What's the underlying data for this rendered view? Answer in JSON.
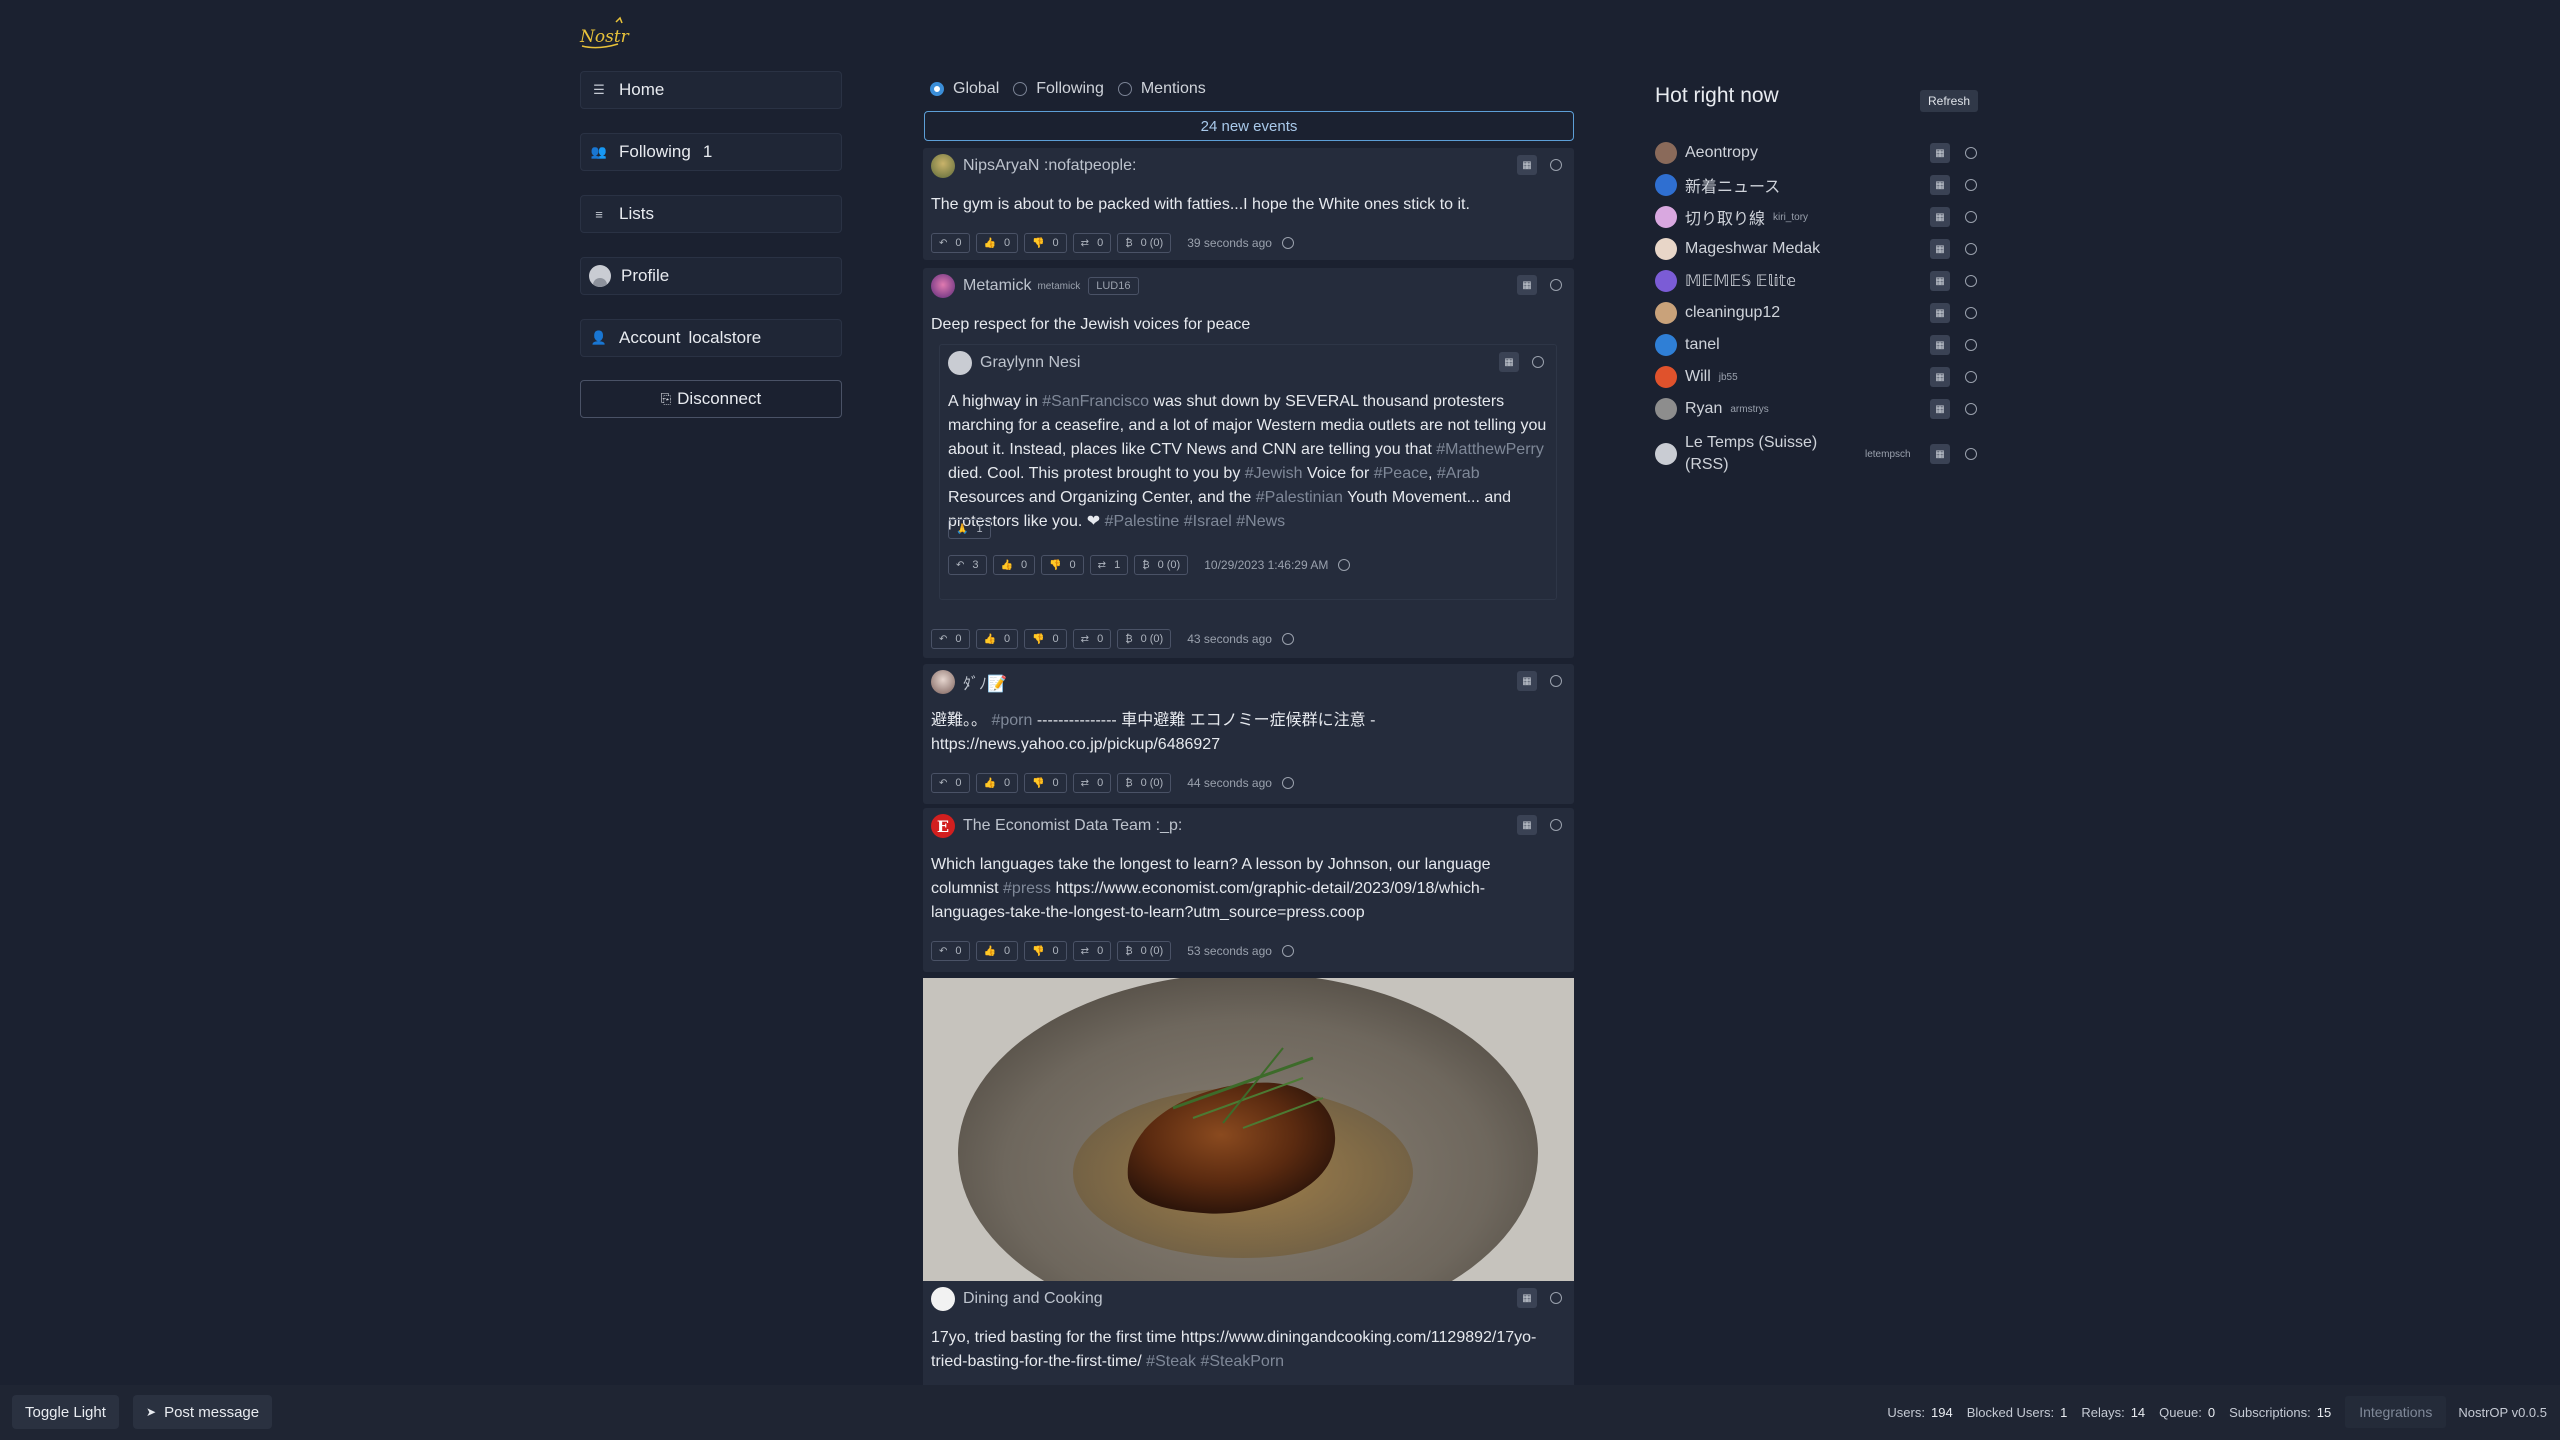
{
  "app": {
    "logo_text": "NOSTR",
    "version": "NostrOP v0.0.5"
  },
  "nav": {
    "home": "Home",
    "following": "Following",
    "following_count": "1",
    "lists": "Lists",
    "profile": "Profile",
    "account": "Account",
    "account_value": "localstore",
    "disconnect": "Disconnect"
  },
  "feed": {
    "filters": [
      {
        "label": "Global",
        "selected": true
      },
      {
        "label": "Following",
        "selected": false
      },
      {
        "label": "Mentions",
        "selected": false
      }
    ],
    "new_events": "24 new events",
    "posts": [
      {
        "author": "NipsAryaN :nofatpeople:",
        "content": "The gym is about to be packed with fatties...I hope the White ones stick to it.",
        "actions": {
          "reply": "0",
          "like": "0",
          "dislike": "0",
          "repost": "0",
          "zap": "0 (0)"
        },
        "time": "39 seconds ago"
      },
      {
        "author": "Metamick",
        "nip05": "metamick",
        "badge": "LUD16",
        "content": "Deep respect for the Jewish voices for peace",
        "quoted": {
          "author": "Graylynn Nesi",
          "content_parts": [
            {
              "t": "A highway in "
            },
            {
              "tag": "#SanFrancisco"
            },
            {
              "t": " was shut down by SEVERAL thousand protesters marching for a ceasefire, and a lot of major Western media outlets are not telling you about it. Instead, places like CTV News and CNN are telling you that "
            },
            {
              "tag": "#MatthewPerry"
            },
            {
              "t": " died. Cool. This protest brought to you by "
            },
            {
              "tag": "#Jewish"
            },
            {
              "t": " Voice for "
            },
            {
              "tag": "#Peace"
            },
            {
              "t": ", "
            },
            {
              "tag": "#Arab"
            },
            {
              "t": " Resources and Organizing Center, and the "
            },
            {
              "tag": "#Palestinian"
            },
            {
              "t": " Youth Movement... and protestors like you. ❤ "
            },
            {
              "tag": "#Palestine"
            },
            {
              "t": " "
            },
            {
              "tag": "#Israel"
            },
            {
              "t": " "
            },
            {
              "tag": "#News"
            }
          ],
          "reaction": "1",
          "actions": {
            "reply": "3",
            "like": "0",
            "dislike": "0",
            "repost": "1",
            "zap": "0 (0)"
          },
          "time": "10/29/2023 1:46:29 AM"
        },
        "actions": {
          "reply": "0",
          "like": "0",
          "dislike": "0",
          "repost": "0",
          "zap": "0 (0)"
        },
        "time": "43 seconds ago"
      },
      {
        "author": "ﾀﾞﾉ📝",
        "content_parts": [
          {
            "t": "避難。。"
          },
          {
            "tag": " #porn"
          },
          {
            "t": " --------------- 車中避難 エコノミー症候群に注意 - https://news.yahoo.co.jp/pickup/6486927"
          }
        ],
        "actions": {
          "reply": "0",
          "like": "0",
          "dislike": "0",
          "repost": "0",
          "zap": "0 (0)"
        },
        "time": "44 seconds ago"
      },
      {
        "author": "The Economist Data Team :_p:",
        "content_parts": [
          {
            "t": "Which languages take the longest to learn? A lesson by Johnson, our language columnist "
          },
          {
            "tag": "#press"
          },
          {
            "t": " https://www.economist.com/graphic-detail/2023/09/18/which-languages-take-the-longest-to-learn?utm_source=press.coop"
          }
        ],
        "actions": {
          "reply": "0",
          "like": "0",
          "dislike": "0",
          "repost": "0",
          "zap": "0 (0)"
        },
        "time": "53 seconds ago"
      },
      {
        "author": "Dining and Cooking",
        "content_parts": [
          {
            "t": "17yo, tried basting for the first time https://www.diningandcooking.com/1129892/17yo-tried-basting-for-the-first-time/ "
          },
          {
            "tag": "#Steak"
          },
          {
            "t": " "
          },
          {
            "tag": "#SteakPorn"
          }
        ]
      }
    ]
  },
  "hot": {
    "title": "Hot right now",
    "refresh": "Refresh",
    "items": [
      {
        "name": "Aeontropy",
        "sub": "",
        "color": "#8a6a5a"
      },
      {
        "name": "新着ニュース",
        "sub": "",
        "color": "#2f6fd1"
      },
      {
        "name": "切り取り線",
        "sub": "kiri_tory",
        "color": "#d9a8e0"
      },
      {
        "name": "Mageshwar Medak",
        "sub": "",
        "color": "#e8d6c8"
      },
      {
        "name": "𝕄𝔼𝕄𝔼𝕊 𝔼𝕝𝕚𝕥𝕖",
        "sub": "",
        "color": "#7b5cd6"
      },
      {
        "name": "cleaningup12",
        "sub": "",
        "color": "#c9a27a"
      },
      {
        "name": "tanel",
        "sub": "",
        "color": "#2f7fd6"
      },
      {
        "name": "Will",
        "sub": "jb55",
        "color": "#e0522c"
      },
      {
        "name": "Ryan",
        "sub": "armstrys",
        "color": "#8d8d8d"
      },
      {
        "name": "Le Temps (Suisse) (RSS)",
        "sub": "letempsch",
        "color": "#c9ccd3"
      }
    ]
  },
  "bottom": {
    "toggle": "Toggle Light",
    "post": "Post message",
    "users_label": "Users:",
    "users": "194",
    "blocked_label": "Blocked Users:",
    "blocked": "1",
    "relays_label": "Relays:",
    "relays": "14",
    "queue_label": "Queue:",
    "queue": "0",
    "subs_label": "Subscriptions:",
    "subs": "15",
    "integrations": "Integrations"
  },
  "colors": {
    "bg": "#1b2130",
    "card": "#252c3c",
    "accent": "#3b8ed8",
    "logo": "#e8c23a"
  }
}
